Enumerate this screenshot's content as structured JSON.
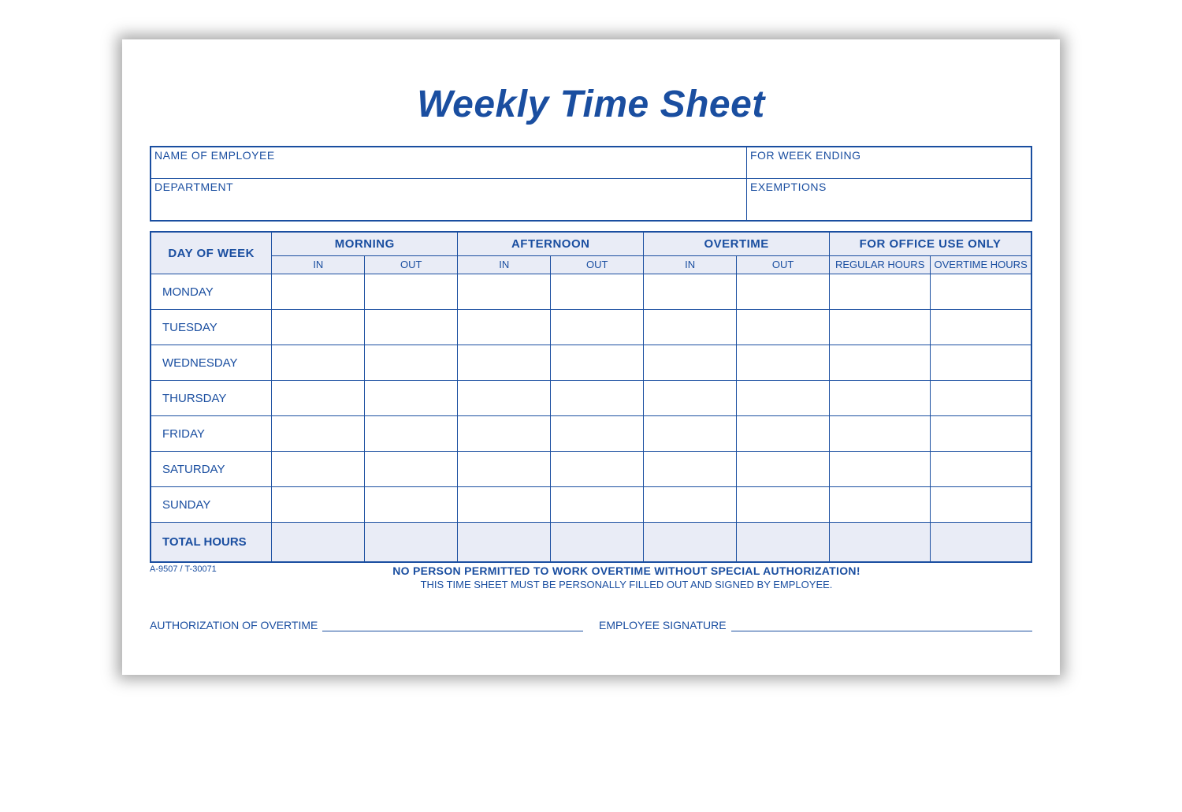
{
  "title": "Weekly Time Sheet",
  "info": {
    "employee_label": "NAME OF EMPLOYEE",
    "week_ending_label": "FOR WEEK ENDING",
    "department_label": "DEPARTMENT",
    "exemptions_label": "EXEMPTIONS"
  },
  "table": {
    "day_of_week_label": "DAY OF WEEK",
    "periods": [
      "MORNING",
      "AFTERNOON",
      "OVERTIME"
    ],
    "in_label": "IN",
    "out_label": "OUT",
    "office_use_label": "FOR OFFICE USE ONLY",
    "regular_hours_label": "REGULAR HOURS",
    "overtime_hours_label": "OVERTIME HOURS",
    "days": [
      "MONDAY",
      "TUESDAY",
      "WEDNESDAY",
      "THURSDAY",
      "FRIDAY",
      "SATURDAY",
      "SUNDAY"
    ],
    "total_label": "TOTAL HOURS"
  },
  "footer": {
    "form_id": "A-9507 / T-30071",
    "notice_bold": "NO PERSON PERMITTED TO WORK OVERTIME WITHOUT SPECIAL AUTHORIZATION!",
    "notice_sub": "THIS TIME SHEET MUST BE PERSONALLY FILLED OUT AND SIGNED BY EMPLOYEE.",
    "auth_label": "AUTHORIZATION OF OVERTIME",
    "sig_label": "EMPLOYEE SIGNATURE"
  }
}
